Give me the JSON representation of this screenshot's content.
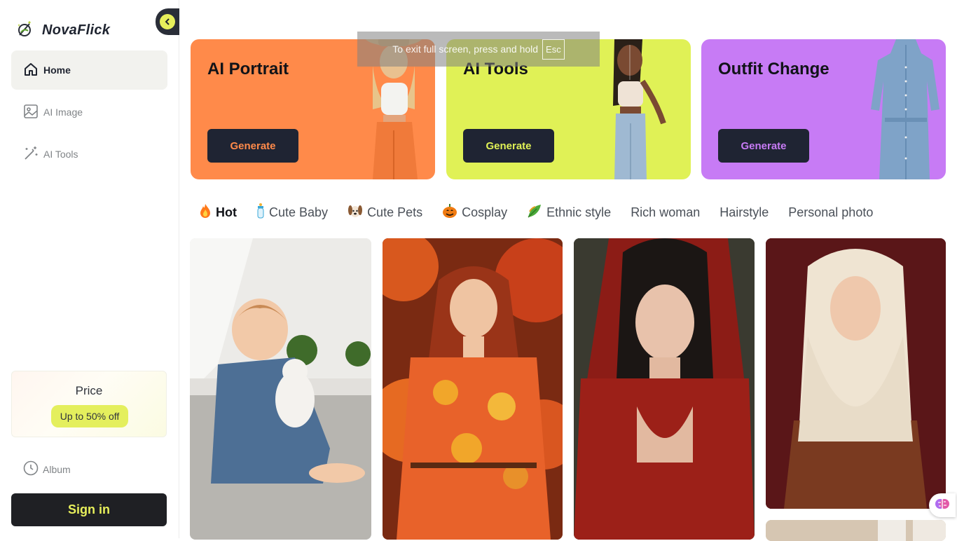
{
  "app": {
    "name": "NovaFlick"
  },
  "sidebar": {
    "collapse_icon": "chevron-left-icon",
    "nav": [
      {
        "label": "Home",
        "icon": "home-icon",
        "active": true
      },
      {
        "label": "AI Image",
        "icon": "image-icon",
        "active": false
      },
      {
        "label": "AI Tools",
        "icon": "magic-wand-icon",
        "active": false
      }
    ],
    "price": {
      "title": "Price",
      "badge": "Up to 50% off"
    },
    "album": {
      "label": "Album",
      "icon": "clock-icon"
    },
    "sign_in": "Sign in"
  },
  "hero_cards": [
    {
      "title": "AI Portrait",
      "button": "Generate",
      "color": "#ff8a4a",
      "button_text_color": "#ff8a4a"
    },
    {
      "title": "AI Tools",
      "button": "Generate",
      "color": "#e0f156",
      "button_text_color": "#e0f156"
    },
    {
      "title": "Outfit Change",
      "button": "Generate",
      "color": "#c77bf5",
      "button_text_color": "#c77bf5"
    }
  ],
  "fullscreen_toast": {
    "message": "To exit full screen, press and hold",
    "key": "Esc"
  },
  "categories": [
    {
      "label": "Hot",
      "icon": "fire-icon",
      "active": true
    },
    {
      "label": "Cute Baby",
      "icon": "baby-bottle-icon",
      "active": false
    },
    {
      "label": "Cute Pets",
      "icon": "dog-icon",
      "active": false
    },
    {
      "label": "Cosplay",
      "icon": "pumpkin-icon",
      "active": false
    },
    {
      "label": "Ethnic style",
      "icon": "leaf-icon",
      "active": false
    },
    {
      "label": "Rich woman",
      "active": false
    },
    {
      "label": "Hairstyle",
      "active": false
    },
    {
      "label": "Personal photo",
      "active": false
    }
  ],
  "gallery": [
    {
      "subject": "baby-with-plush-bunny"
    },
    {
      "subject": "woman-in-autumn-leaves-dress"
    },
    {
      "subject": "woman-in-red-hood"
    },
    {
      "subject": "woman-in-hijab"
    },
    {
      "subject": "room-interior"
    }
  ],
  "colors": {
    "accent": "#e7ef5b",
    "dark": "#1f2433"
  }
}
